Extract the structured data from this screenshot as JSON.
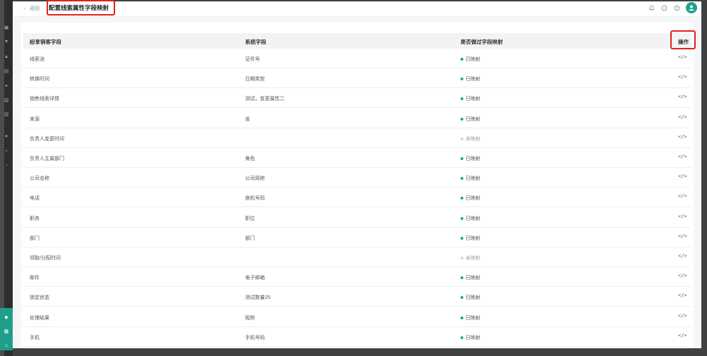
{
  "header": {
    "back_label": "返回",
    "page_title": "配置线索属性字段映射"
  },
  "table": {
    "columns": [
      "纷享销客字段",
      "系统字段",
      "是否做过字段映射",
      "操作"
    ],
    "rows": [
      {
        "source": "线索池",
        "target": "证件号",
        "status": "已映射",
        "mapped": true
      },
      {
        "source": "转换时间",
        "target": "日期类型",
        "status": "已映射",
        "mapped": true
      },
      {
        "source": "销售线索详情",
        "target": "测试，变更属性二",
        "status": "已映射",
        "mapped": true
      },
      {
        "source": "来源",
        "target": "省",
        "status": "已映射",
        "mapped": true
      },
      {
        "source": "负责人变更时间",
        "target": "",
        "status": "未映射",
        "mapped": false
      },
      {
        "source": "负责人主属部门",
        "target": "角色",
        "status": "已映射",
        "mapped": true
      },
      {
        "source": "公司名称",
        "target": "公司简称",
        "status": "已映射",
        "mapped": true
      },
      {
        "source": "电话",
        "target": "座机号码",
        "status": "已映射",
        "mapped": true
      },
      {
        "source": "职务",
        "target": "职位",
        "status": "已映射",
        "mapped": true
      },
      {
        "source": "部门",
        "target": "部门",
        "status": "已映射",
        "mapped": true
      },
      {
        "source": "领取/分配时间",
        "target": "",
        "status": "未映射",
        "mapped": false
      },
      {
        "source": "邮件",
        "target": "电子邮箱",
        "status": "已映射",
        "mapped": true
      },
      {
        "source": "锁定状态",
        "target": "测试数量25",
        "status": "已映射",
        "mapped": true
      },
      {
        "source": "处理结果",
        "target": "昵称",
        "status": "已映射",
        "mapped": true
      },
      {
        "source": "手机",
        "target": "手机号码",
        "status": "已映射",
        "mapped": true
      }
    ]
  },
  "icons": {
    "operation": "</>"
  },
  "colors": {
    "mapped": "#1bb35a",
    "unmapped": "#d6d8dc",
    "accent": "#1fa38c",
    "highlight": "#e0231b"
  }
}
